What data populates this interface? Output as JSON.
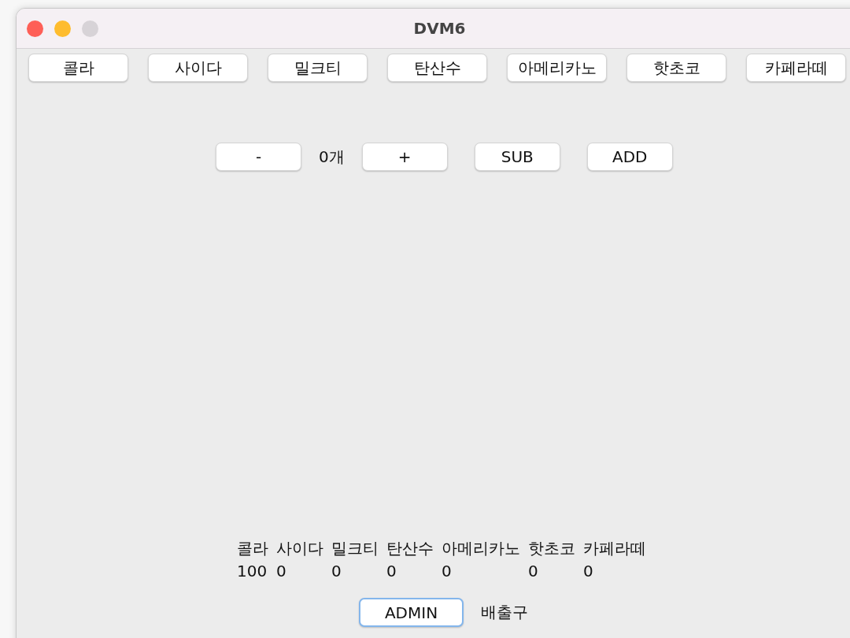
{
  "window": {
    "title": "DVM6"
  },
  "products": [
    "콜라",
    "사이다",
    "밀크티",
    "탄산수",
    "아메리카노",
    "핫초코",
    "카페라떼"
  ],
  "counter": {
    "minus": "-",
    "count": "0개",
    "plus": "+"
  },
  "actions": [
    "SUB",
    "ADD"
  ],
  "stock": [
    {
      "name": "콜라",
      "count": "100"
    },
    {
      "name": "사이다",
      "count": "0"
    },
    {
      "name": "밀크티",
      "count": "0"
    },
    {
      "name": "탄산수",
      "count": "0"
    },
    {
      "name": "아메리카노",
      "count": "0"
    },
    {
      "name": "핫초코",
      "count": "0"
    },
    {
      "name": "카페라떼",
      "count": "0"
    }
  ],
  "admin_button": {
    "label": "ADMIN",
    "focused": true
  },
  "outlet_label": "배출구"
}
